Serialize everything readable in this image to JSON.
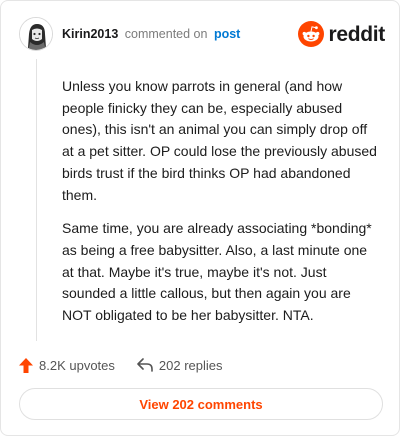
{
  "header": {
    "username": "Kirin2013",
    "commented_on": "commented on",
    "post_link": "post"
  },
  "brand": {
    "name": "reddit",
    "accent_color": "#ff4500",
    "logo_icon": "reddit-snoo-icon"
  },
  "comment": {
    "paragraphs": [
      "Unless you know parrots in general (and how people finicky they can be, especially abused ones), this isn't an animal you can simply drop off at a pet sitter. OP could lose the previously abused birds trust if the bird thinks OP had abandoned them.",
      "Same time, you are already associating *bonding* as being a free babysitter. Also, a last minute one at that. Maybe it's true, maybe it's not. Just sounded a little callous, but then again you are NOT obligated to be her babysitter. NTA."
    ]
  },
  "actions": {
    "upvotes_label": "8.2K upvotes",
    "upvote_icon": "upvote-arrow-icon",
    "replies_label": "202 replies",
    "reply_icon": "reply-arrow-icon"
  },
  "view_comments_label": "View 202 comments"
}
